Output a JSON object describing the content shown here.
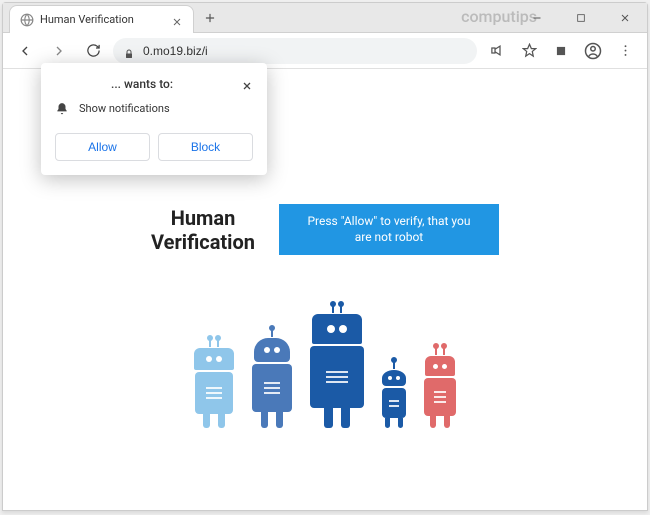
{
  "browser": {
    "tab_title": "Human Verification",
    "url": "0.mo19.biz/i",
    "watermark": "computips"
  },
  "permission": {
    "wants_to": "... wants to:",
    "show_notifications": "Show notifications",
    "allow": "Allow",
    "block": "Block"
  },
  "page": {
    "title_line1": "Human",
    "title_line2": "Verification",
    "banner": "Press \"Allow\" to verify, that you are not robot"
  },
  "colors": {
    "accent_blue": "#2196e3",
    "link_blue": "#1a73e8",
    "robot_light": "#8fc6ea",
    "robot_mid": "#4a79b9",
    "robot_dark": "#1b5aa6",
    "robot_red": "#e06a6a"
  }
}
